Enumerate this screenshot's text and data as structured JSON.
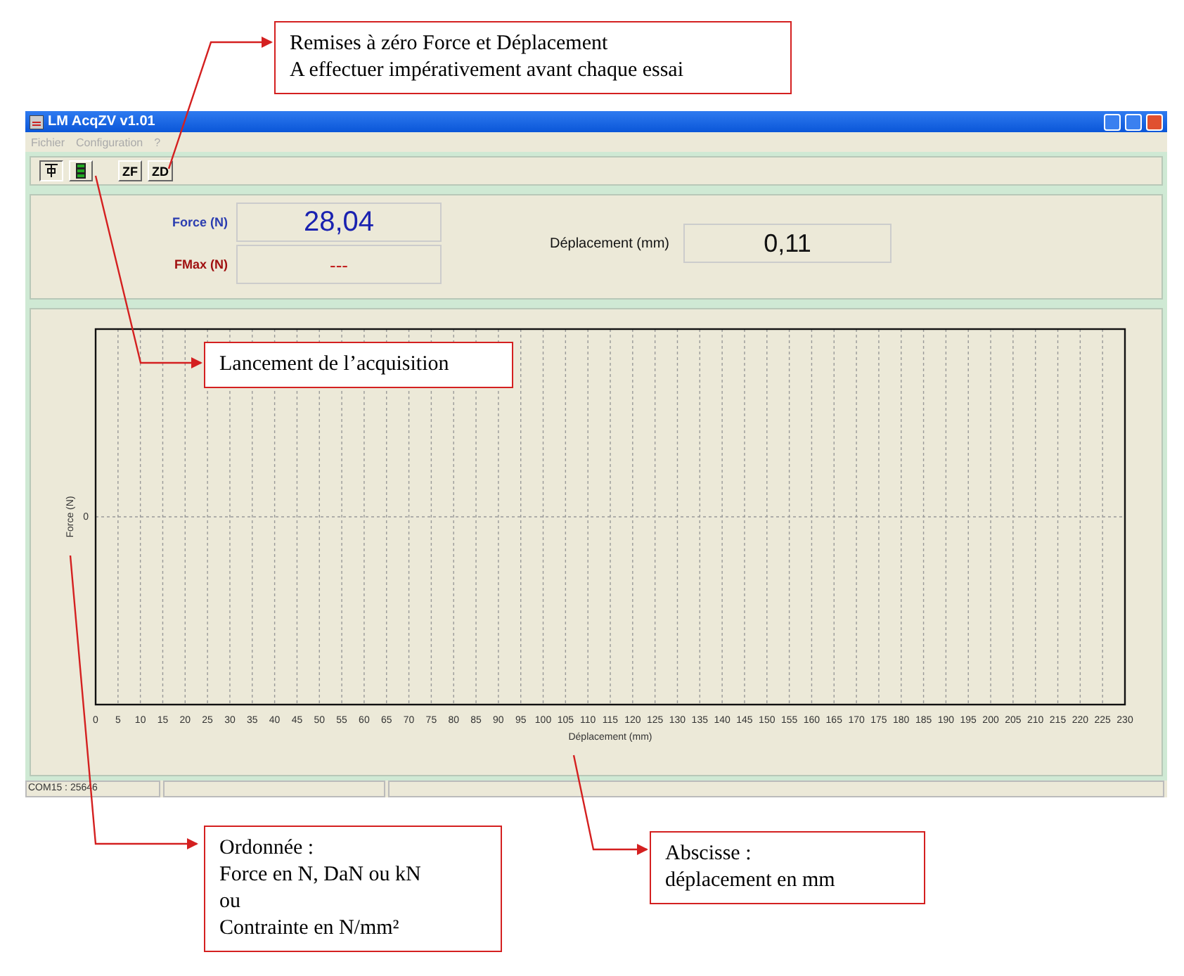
{
  "window": {
    "title": "LM AcqZV v1.01",
    "menu": [
      "Fichier",
      "Configuration",
      "?"
    ],
    "toolbar": [
      {
        "kind": "antenna",
        "selected": true
      },
      {
        "kind": "signal",
        "selected": false
      },
      {
        "kind": "text",
        "label": "ZF",
        "selected": false
      },
      {
        "kind": "text",
        "label": "ZD",
        "selected": false
      }
    ],
    "readings": {
      "force_label": "Force (N)",
      "force_value": "28,04",
      "fmax_label": "FMax (N)",
      "fmax_value": "---",
      "displacement_label": "Déplacement (mm)",
      "displacement_value": "0,11"
    },
    "chart": {
      "y_axis_title": "Force (N)",
      "y_tick_label": "0",
      "x_tick_labels": [
        "0",
        "5",
        "10",
        "15",
        "20",
        "25",
        "30",
        "35",
        "40",
        "45",
        "50",
        "55",
        "60",
        "65",
        "70",
        "75",
        "80",
        "85",
        "90",
        "95",
        "100",
        "105",
        "110",
        "115",
        "120",
        "125",
        "130",
        "135",
        "140",
        "145",
        "150",
        "155",
        "160",
        "165",
        "170",
        "175",
        "180",
        "185",
        "190",
        "195",
        "200",
        "205",
        "210",
        "215",
        "220",
        "225",
        "230"
      ],
      "x_axis_title": "Déplacement (mm)"
    },
    "status_bar": [
      "COM15 : 25646"
    ]
  },
  "callouts": [
    {
      "text": "Remises à zéro Force et Déplacement\nA effectuer impérativement avant chaque essai"
    },
    {
      "text": "Lancement de l’acquisition"
    },
    {
      "text": "Ordonnée :\nForce en N, DaN ou kN\nou\nContrainte en N/mm²"
    },
    {
      "text": "Abscisse :\ndéplacement en mm"
    }
  ]
}
